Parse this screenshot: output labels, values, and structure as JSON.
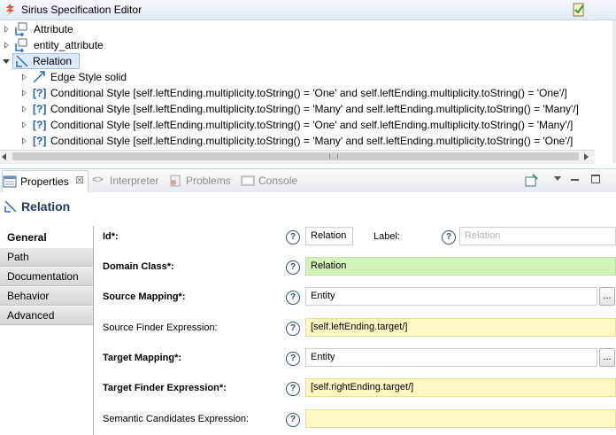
{
  "editor": {
    "title": "Sirius Specification Editor",
    "tree": [
      {
        "label": "Attribute",
        "icon": "node-mapping-icon",
        "state": "closed"
      },
      {
        "label": "entity_attribute",
        "icon": "node-mapping-icon",
        "state": "closed"
      },
      {
        "label": "Relation",
        "icon": "edge-mapping-icon",
        "state": "open",
        "selected": true
      },
      {
        "label": "Edge Style solid",
        "icon": "edge-style-icon",
        "state": "closed"
      },
      {
        "qm": "[?]",
        "label": "Conditional Style [self.leftEnding.multiplicity.toString() = 'One' and self.leftEnding.multiplicity.toString() = 'One'/]",
        "state": "closed"
      },
      {
        "qm": "[?]",
        "label": "Conditional Style [self.leftEnding.multiplicity.toString() = 'Many' and self.leftEnding.multiplicity.toString() = 'Many'/]",
        "state": "closed"
      },
      {
        "qm": "[?]",
        "label": "Conditional Style [self.leftEnding.multiplicity.toString() = 'One' and self.leftEnding.multiplicity.toString() = 'Many'/]",
        "state": "closed"
      },
      {
        "qm": "[?]",
        "label": "Conditional Style [self.leftEnding.multiplicity.toString() = 'Many' and self.leftEnding.multiplicity.toString() = 'One'/]",
        "state": "closed"
      }
    ]
  },
  "views": {
    "tabs": [
      {
        "label": "Properties",
        "close": "☒",
        "active": true
      },
      {
        "label": "Interpreter",
        "active": false
      },
      {
        "label": "Problems",
        "active": false
      },
      {
        "label": "Console",
        "active": false
      }
    ]
  },
  "properties": {
    "title": "Relation",
    "side_tabs": [
      "General",
      "Path",
      "Documentation",
      "Behavior",
      "Advanced"
    ],
    "help": "?",
    "browse": "...",
    "fields": {
      "id": {
        "label": "Id*:",
        "value": "Relation",
        "label2": "Label:",
        "placeholder": "Relation"
      },
      "domain_class": {
        "label": "Domain Class*:",
        "value": "Relation"
      },
      "source_mapping": {
        "label": "Source Mapping*:",
        "value": "Entity"
      },
      "source_finder": {
        "label": "Source Finder Expression:",
        "value": "[self.leftEnding.target/]"
      },
      "target_mapping": {
        "label": "Target Mapping*:",
        "value": "Entity"
      },
      "target_finder": {
        "label": "Target Finder Expression*:",
        "value": "[self.rightEnding.target/]"
      },
      "semantic_candidates": {
        "label": "Semantic Candidates Expression:",
        "value": ""
      }
    }
  },
  "colors": {
    "green_field": "#d2f2b8",
    "yellow_field": "#fff8c4",
    "title_text": "#203a5a"
  }
}
